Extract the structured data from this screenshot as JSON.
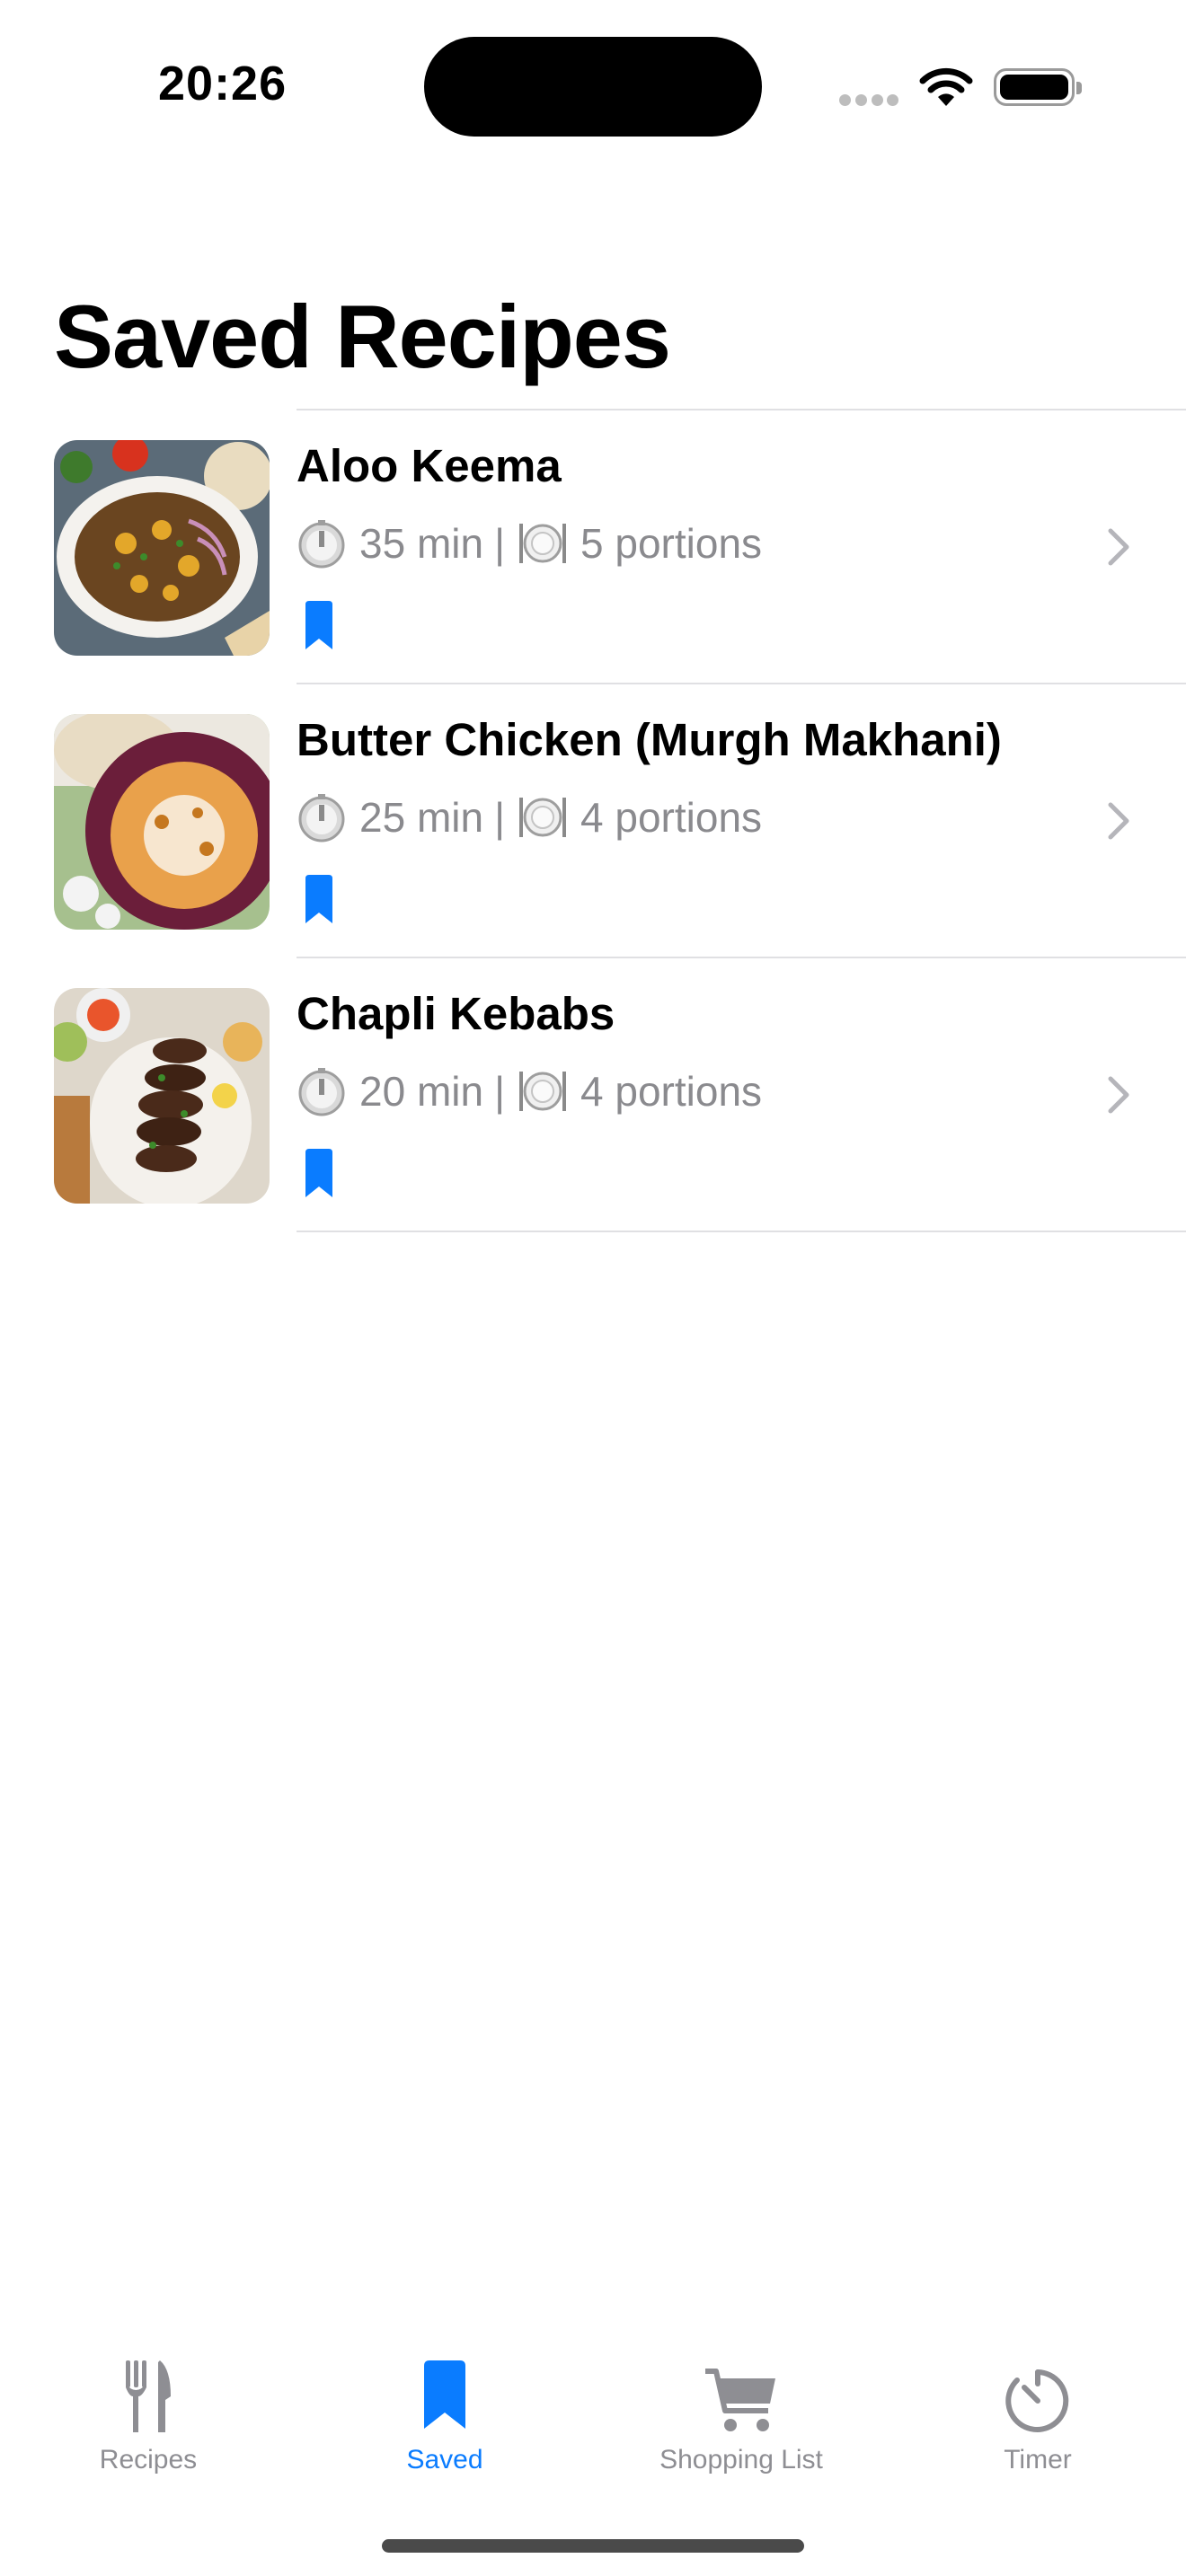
{
  "status_bar": {
    "time": "20:26"
  },
  "page": {
    "title": "Saved Recipes"
  },
  "recipes": [
    {
      "name": "Aloo Keema",
      "time": "35 min",
      "separator": "|",
      "portions": "5 portions"
    },
    {
      "name": "Butter Chicken (Murgh Makhani)",
      "time": "25 min",
      "separator": "|",
      "portions": "4 portions"
    },
    {
      "name": "Chapli Kebabs",
      "time": "20 min",
      "separator": "|",
      "portions": "4 portions"
    }
  ],
  "icons": {
    "time": "stopwatch-emoji",
    "portions": "fork-knife-plate-emoji",
    "saved_marker": "bookmark-icon",
    "disclosure": "chevron-right-icon"
  },
  "tabs": [
    {
      "label": "Recipes",
      "icon": "fork-knife-icon",
      "active": false
    },
    {
      "label": "Saved",
      "icon": "bookmark-icon",
      "active": true
    },
    {
      "label": "Shopping List",
      "icon": "cart-icon",
      "active": false
    },
    {
      "label": "Timer",
      "icon": "timer-icon",
      "active": false
    }
  ],
  "colors": {
    "accent": "#0a7cff",
    "secondary_text": "#8a8a8e",
    "inactive_tab": "#8e8e93"
  }
}
